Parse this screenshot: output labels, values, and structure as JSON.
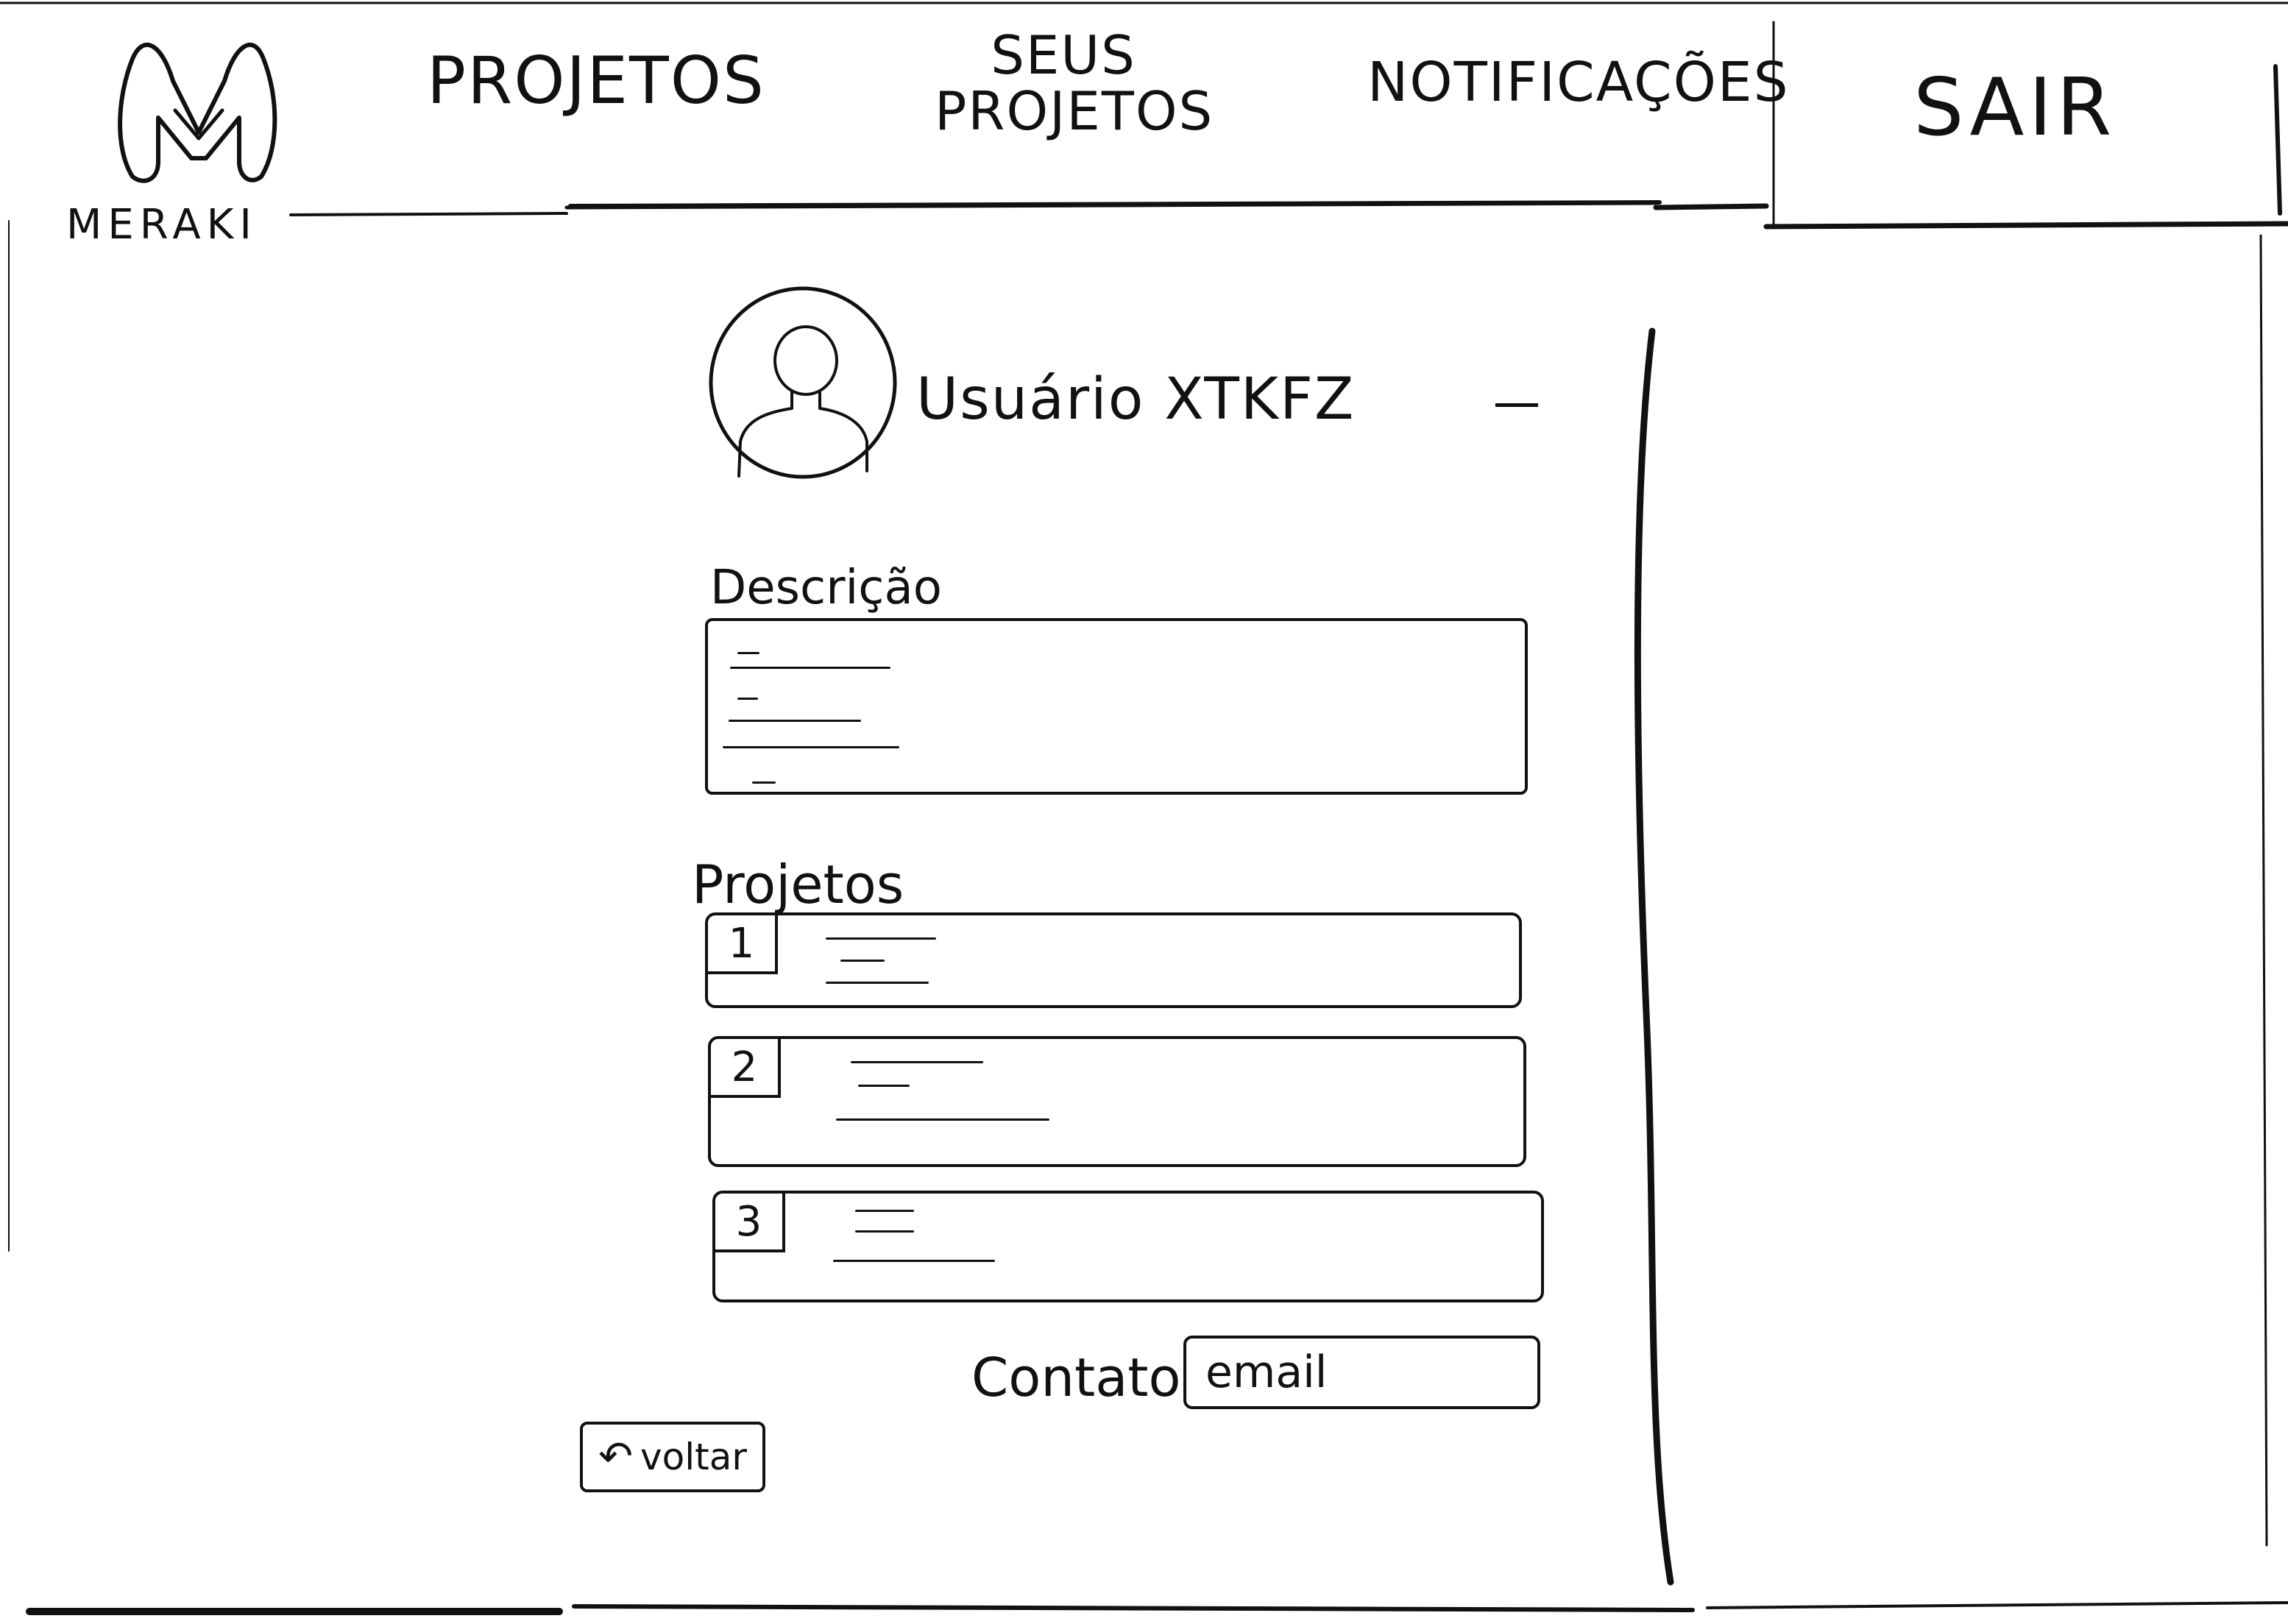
{
  "brand": {
    "name": "MERAKI",
    "logo_letter": "M"
  },
  "nav": {
    "projetos": "PROJETOS",
    "seus_projetos_line1": "SEUS",
    "seus_projetos_line2": "PROJETOS",
    "notificacoes": "NOTIFICAÇÕES",
    "sair": "SAIR"
  },
  "profile": {
    "username": "Usuário XTKFZ",
    "avatar_icon": "user-avatar-icon"
  },
  "description": {
    "label": "Descrição"
  },
  "projects": {
    "label": "Projetos",
    "items": [
      {
        "number": "1"
      },
      {
        "number": "2"
      },
      {
        "number": "3"
      }
    ]
  },
  "contact": {
    "label": "Contato",
    "email_placeholder": "email"
  },
  "back": {
    "label": "voltar",
    "icon": "back-arrow-icon"
  },
  "colors": {
    "ink": "#111111",
    "paper": "#ffffff"
  }
}
